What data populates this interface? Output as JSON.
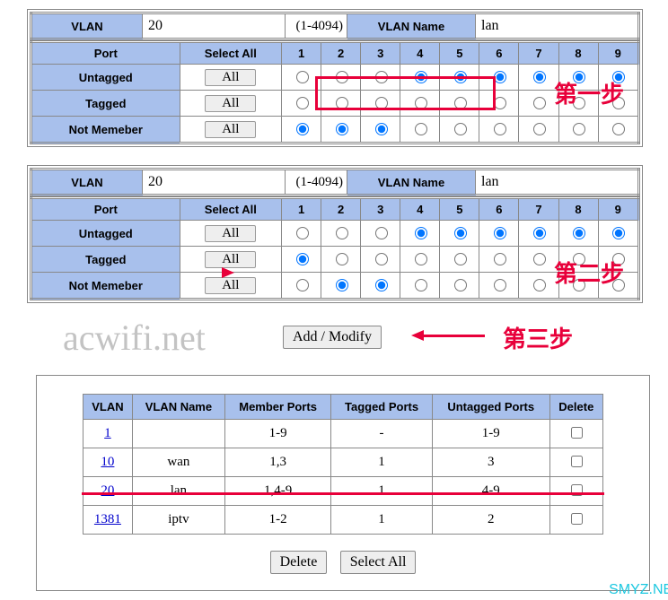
{
  "config1": {
    "vlan_label": "VLAN",
    "vlan_value": "20",
    "vlan_range": "(1-4094)",
    "name_label": "VLAN Name",
    "name_value": "lan",
    "port_label": "Port",
    "select_all_label": "Select All",
    "all_btn": "All",
    "ports": [
      "1",
      "2",
      "3",
      "4",
      "5",
      "6",
      "7",
      "8",
      "9"
    ],
    "rows": [
      {
        "label": "Untagged",
        "sel": [
          0,
          0,
          0,
          1,
          1,
          1,
          1,
          1,
          1
        ]
      },
      {
        "label": "Tagged",
        "sel": [
          0,
          0,
          0,
          0,
          0,
          0,
          0,
          0,
          0
        ]
      },
      {
        "label": "Not Memeber",
        "sel": [
          1,
          1,
          1,
          0,
          0,
          0,
          0,
          0,
          0
        ]
      }
    ]
  },
  "step1": "第一步",
  "config2": {
    "vlan_label": "VLAN",
    "vlan_value": "20",
    "vlan_range": "(1-4094)",
    "name_label": "VLAN Name",
    "name_value": "lan",
    "port_label": "Port",
    "select_all_label": "Select All",
    "all_btn": "All",
    "ports": [
      "1",
      "2",
      "3",
      "4",
      "5",
      "6",
      "7",
      "8",
      "9"
    ],
    "rows": [
      {
        "label": "Untagged",
        "sel": [
          0,
          0,
          0,
          1,
          1,
          1,
          1,
          1,
          1
        ]
      },
      {
        "label": "Tagged",
        "sel": [
          1,
          0,
          0,
          0,
          0,
          0,
          0,
          0,
          0
        ]
      },
      {
        "label": "Not Memeber",
        "sel": [
          0,
          1,
          1,
          0,
          0,
          0,
          0,
          0,
          0
        ]
      }
    ]
  },
  "step2": "第二步",
  "step3": "第三步",
  "add_modify": "Add / Modify",
  "watermark": "acwifi.net",
  "vlan_table": {
    "headers": [
      "VLAN",
      "VLAN Name",
      "Member Ports",
      "Tagged Ports",
      "Untagged Ports",
      "Delete"
    ],
    "rows": [
      {
        "id": "1",
        "name": "",
        "members": "1-9",
        "tagged": "-",
        "untagged": "1-9",
        "del": false
      },
      {
        "id": "10",
        "name": "wan",
        "members": "1,3",
        "tagged": "1",
        "untagged": "3",
        "del": false
      },
      {
        "id": "20",
        "name": "lan",
        "members": "1,4-9",
        "tagged": "1",
        "untagged": "4-9",
        "del": false
      },
      {
        "id": "1381",
        "name": "iptv",
        "members": "1-2",
        "tagged": "1",
        "untagged": "2",
        "del": false
      }
    ]
  },
  "delete_btn": "Delete",
  "select_all_btn": "Select All",
  "smyz": "SMYZ.NET"
}
